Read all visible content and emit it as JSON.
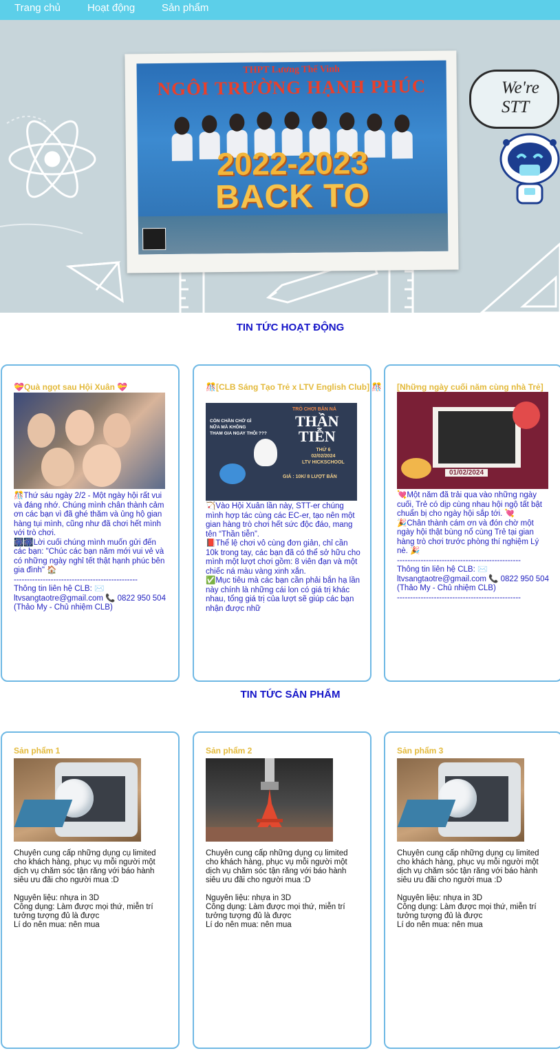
{
  "nav": {
    "items": [
      "Trang chủ",
      "Hoạt động",
      "Sản phẩm"
    ]
  },
  "hero": {
    "photo_line1": "THPT Lương Thế Vinh",
    "photo_line2": "NGÔI TRƯỜNG HẠNH PHÚC",
    "photo_line3": "2022-2023",
    "photo_line4": "BACK TO SCHOOL",
    "bubble_line1": "We're",
    "bubble_line2": "STT"
  },
  "news": {
    "title": "TIN TỨC HOẠT ĐỘNG",
    "cards": [
      {
        "title": "💝Quà ngọt sau Hội Xuân 💝",
        "paragraphs": [
          "🎊Thứ sáu ngày 2/2 - Một ngày hội rất vui và đáng nhớ. Chúng mình chân thành cảm ơn các bạn vì đã ghé thăm và ủng hộ gian hàng tụi mình, cũng như đã chơi hết mình với trò chơi.",
          "🎆🎆Lời cuối chúng mình muốn gửi đến các bạn: \"Chúc các bạn năm mới vui vẻ và có những ngày nghỉ tết thật hạnh phúc bên gia đình\" 🏠",
          "-----------------------------------------------",
          "Thông tin liên hệ CLB: ✉️ ltvsangtaotre@gmail.com 📞 0822 950 504 (Thảo My - Chủ nhiệm CLB)"
        ]
      },
      {
        "title": "🎊[CLB Sáng Tạo Trẻ x LTV English Club] 🎊",
        "image_text": [
          "CÒN CHẦN CHỜ GÌ",
          "NỮA MÀ KHÔNG",
          "THAM GIA NGAY THÔI ???",
          "TRÒ CHƠI BẮN NÁ",
          "THẦN",
          "TIỄN",
          "THỨ 6",
          "02/02/2024",
          "LTV HICKSCHOOL",
          "GIÁ : 10K/ 8 LƯỢT BẮN"
        ],
        "paragraphs": [
          "🏹Vào Hội Xuân lần này, STT-er chúng mình hợp tác cùng các EC-er, tạo nên một gian hàng trò chơi hết sức độc đáo, mang tên “Thần tiễn”.",
          "📕Thể lệ chơi vô cùng đơn giản, chỉ cần 10k trong tay, các bạn đã có thể sở hữu cho mình một lượt chơi gồm: 8 viên đạn và một chiếc ná màu vàng xinh xắn.",
          "✅Mục tiêu mà các bạn cần phải bắn hạ lần này chính là những cái lon có giá trị khác nhau, tổng giá trị của lượt sẽ giúp các bạn nhận được nhữ"
        ]
      },
      {
        "title": "[Những ngày cuối năm cùng nhà Trẻ]",
        "image_text": "01/02/2024",
        "paragraphs": [
          "💘Một năm đã trải qua vào những ngày cuối, Trẻ có dịp cùng nhau hội ngộ tất bật chuẩn bị cho ngày hội sắp tới. 💘",
          "🎉Chân thành cám ơn và đón chờ một ngày hội thật bùng nổ cùng Trẻ tại gian hàng trò chơi trước phòng thí nghiệm Lý nè. 🎉",
          "-----------------------------------------------",
          "Thông tin liên hệ CLB: ✉️ ltvsangtaotre@gmail.com 📞 0822 950 504 (Thảo My - Chủ nhiệm CLB)",
          "-----------------------------------------------"
        ]
      }
    ]
  },
  "products": {
    "title": "TIN TỨC SẢN PHẨM",
    "cards": [
      {
        "title": "Sản phẩm 1",
        "description": "Chuyên cung cấp những dụng cụ limited cho khách hàng, phục vụ mỗi người một dịch vụ chăm sóc tận răng với báo hành siêu ưu đãi cho người mua :D",
        "material": "Nguyên liệu: nhựa in 3D",
        "usage": "Công dụng: Làm được mọi thứ, miễn trí tưởng tượng đủ là được",
        "reason": "Lí do nên mua: nên mua"
      },
      {
        "title": "Sản phẩm 2",
        "description": "Chuyên cung cấp những dụng cụ limited cho khách hàng, phục vụ mỗi người một dịch vụ chăm sóc tận răng với báo hành siêu ưu đãi cho người mua :D",
        "material": "Nguyên liệu: nhựa in 3D",
        "usage": "Công dụng: Làm được mọi thứ, miễn trí tưởng tượng đủ là được",
        "reason": "Lí do nên mua: nên mua"
      },
      {
        "title": "Sản phẩm 3",
        "description": "Chuyên cung cấp những dụng cụ limited cho khách hàng, phục vụ mỗi người một dịch vụ chăm sóc tận răng với báo hành siêu ưu đãi cho người mua :D",
        "material": "Nguyên liệu: nhựa in 3D",
        "usage": "Công dụng: Làm được mọi thứ, miễn trí tưởng tượng đủ là được",
        "reason": "Lí do nên mua: nên mua"
      }
    ]
  },
  "colors": {
    "nav": "#5ccfe9",
    "section_title": "#1414c8",
    "card_title": "#e3b93a",
    "card_border": "#6eb8e4",
    "news_text": "#1f1fbf"
  }
}
